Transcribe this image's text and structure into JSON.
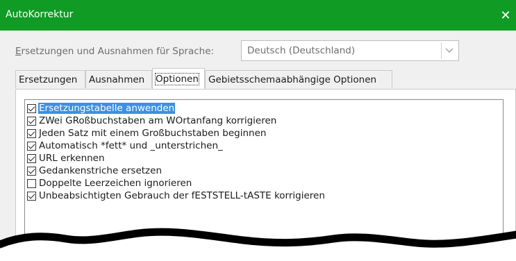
{
  "window": {
    "title": "AutoKorrektur",
    "close_glyph": "✕"
  },
  "language": {
    "label_prefix": "E",
    "label_rest": "rsetzungen und Ausnahmen für Sprache:",
    "selected": "Deutsch (Deutschland)",
    "dropdown_icon": "chevron-down-icon"
  },
  "tabs": [
    {
      "label": "Ersetzungen"
    },
    {
      "label": "Ausnahmen"
    },
    {
      "label": "Optionen",
      "active": true
    },
    {
      "label": "Gebietsschemaabhängige Optionen"
    }
  ],
  "options": [
    {
      "label": "Ersetzungstabelle anwenden",
      "checked": true,
      "selected": true
    },
    {
      "label": "ZWei GRoßbuchstaben am WOrtanfang korrigieren",
      "checked": true
    },
    {
      "label": "Jeden Satz mit einem Großbuchstaben beginnen",
      "checked": true
    },
    {
      "label": "Automatisch *fett* und _unterstrichen_",
      "checked": true
    },
    {
      "label": "URL erkennen",
      "checked": true
    },
    {
      "label": "Gedankenstriche ersetzen",
      "checked": true
    },
    {
      "label": "Doppelte Leerzeichen ignorieren",
      "checked": false
    },
    {
      "label": "Unbeabsichtigten Gebrauch der fESTSTELL-tASTE korrigieren",
      "checked": true
    }
  ],
  "colors": {
    "titlebar": "#0f9b24",
    "selection": "#3c8fe6"
  }
}
